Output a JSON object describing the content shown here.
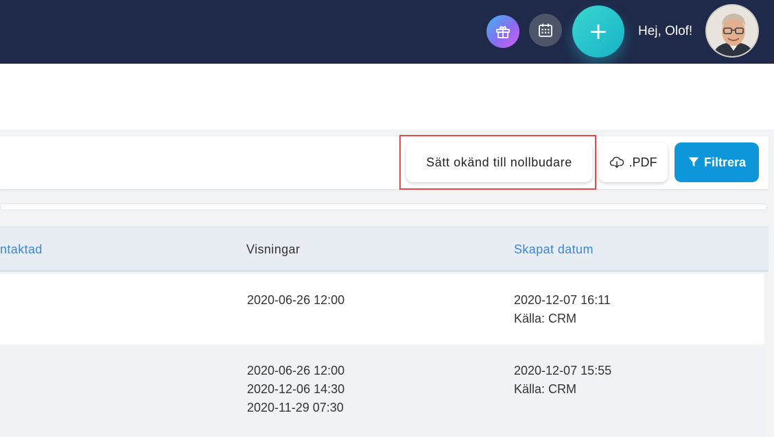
{
  "header": {
    "greeting": "Hej, Olof!",
    "icons": {
      "gift": "gift-icon",
      "calendar": "calendar-icon",
      "add": "plus-icon"
    },
    "add_symbol": "+",
    "colors": {
      "background": "#1f2a4a",
      "add_button": "#17b3c8"
    }
  },
  "toolbar": {
    "set_unknown_label": "Sätt okänd till nollbudare",
    "pdf_label": ".PDF",
    "filter_label": "Filtrera",
    "colors": {
      "filter_button": "#0d96d9",
      "highlight": "#e3484a"
    }
  },
  "table": {
    "columns": [
      "ntaktad",
      "Visningar",
      "Skapat datum"
    ],
    "rows": [
      {
        "visningar": [
          "2020-06-26 12:00"
        ],
        "skapat_datum": "2020-12-07 16:11",
        "kalla": "Källa: CRM"
      },
      {
        "visningar": [
          "2020-06-26 12:00",
          "2020-12-06 14:30",
          "2020-11-29 07:30"
        ],
        "skapat_datum": "2020-12-07 15:55",
        "kalla": "Källa: CRM"
      }
    ],
    "colors": {
      "sortable_header": "#3d86d4"
    }
  }
}
